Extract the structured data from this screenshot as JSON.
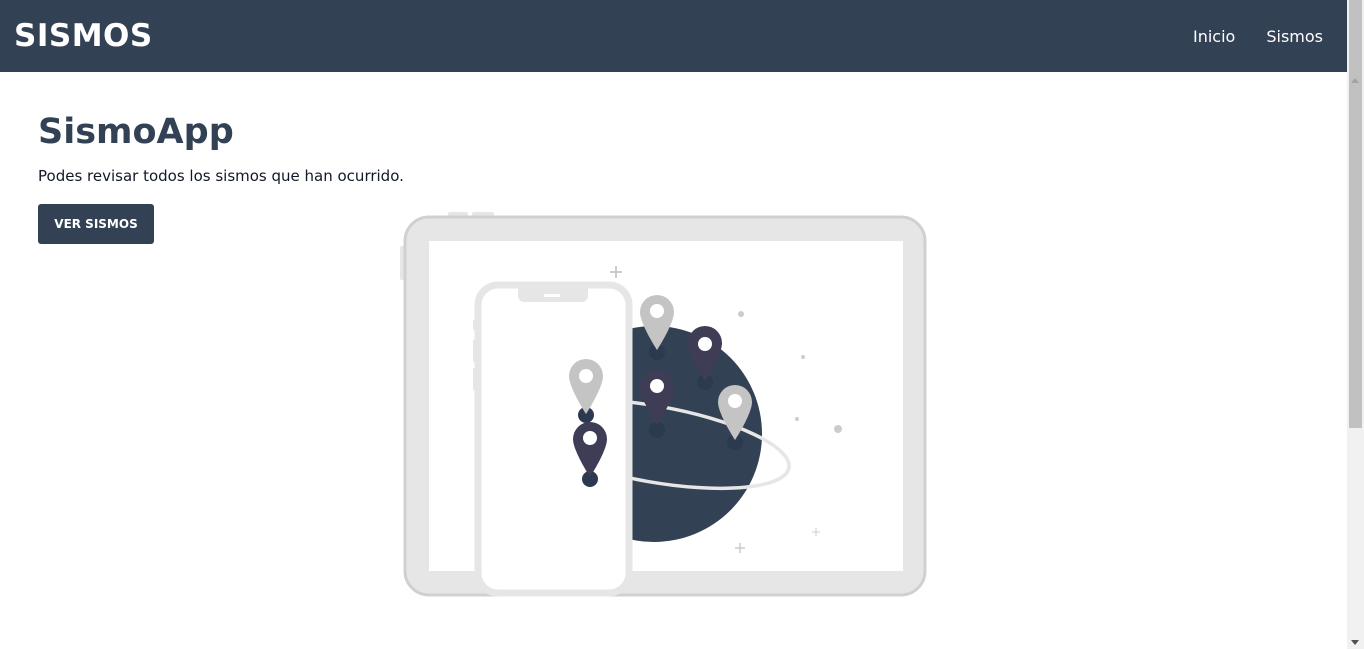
{
  "navbar": {
    "brand": "SISMOS",
    "links": [
      {
        "label": "Inicio"
      },
      {
        "label": "Sismos"
      }
    ]
  },
  "hero": {
    "title": "SismoApp",
    "subtitle": "Podes revisar todos los sismos que han ocurrido.",
    "button_label": "VER SISMOS"
  },
  "illustration": {
    "icons": [
      "tablet-icon",
      "phone-icon",
      "globe-icon",
      "map-pin-icon"
    ]
  },
  "colors": {
    "primary": "#334155",
    "pin_dark": "#3f3d56",
    "device_gray": "#e6e6e6"
  }
}
